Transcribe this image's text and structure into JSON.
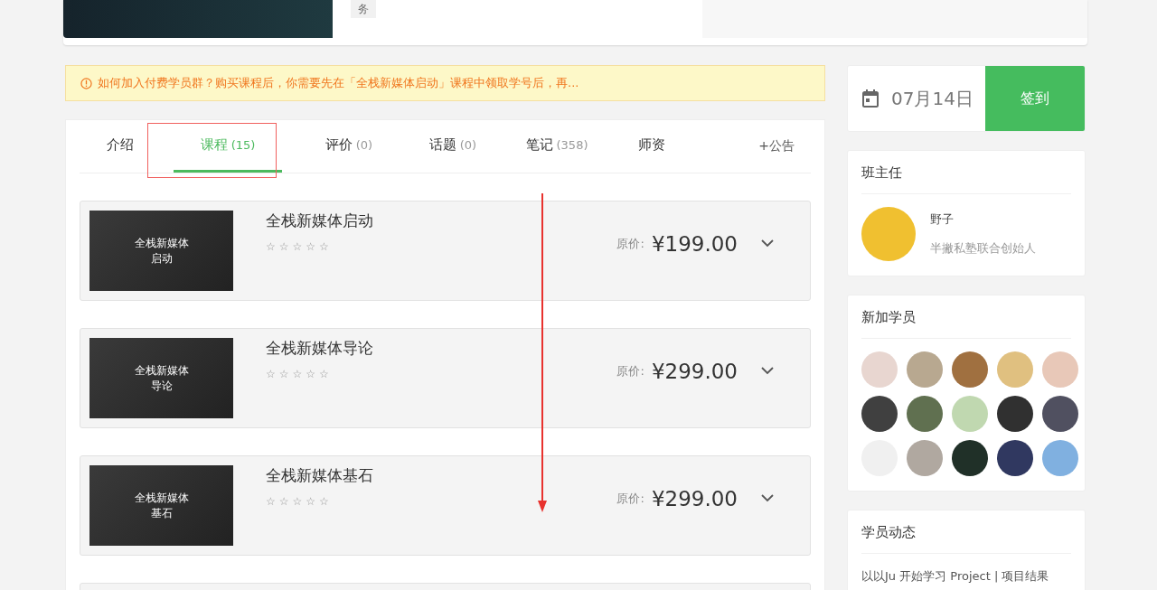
{
  "top_card": {
    "label": "务"
  },
  "notice": {
    "text": "如何加入付费学员群？购买课程后，你需要先在「全栈新媒体启动」课程中领取学号后，再..."
  },
  "tabs": [
    {
      "label": "介绍",
      "selected": false
    },
    {
      "label": "课程",
      "count": "(15)",
      "selected": true
    },
    {
      "label": "评价",
      "count": "(0)",
      "selected": false
    },
    {
      "label": "话题",
      "count": "(0)",
      "selected": false
    },
    {
      "label": "笔记",
      "count": "(358)",
      "selected": false
    },
    {
      "label": "师资",
      "selected": false
    }
  ],
  "announce_button": "+公告",
  "courses": [
    {
      "title": "全栈新媒体启动",
      "thumb_lines": [
        "全栈新媒体",
        "启动"
      ],
      "stars": 0,
      "price_label": "原价:",
      "price": "¥199.00"
    },
    {
      "title": "全栈新媒体导论",
      "thumb_lines": [
        "全栈新媒体",
        "导论"
      ],
      "stars": 0,
      "price_label": "原价:",
      "price": "¥299.00"
    },
    {
      "title": "全栈新媒体基石",
      "thumb_lines": [
        "全栈新媒体",
        "基石"
      ],
      "stars": 0,
      "price_label": "原价:",
      "price": "¥299.00"
    }
  ],
  "checkin": {
    "date": "07月14日",
    "button": "签到"
  },
  "head_teacher": {
    "title": "班主任",
    "name": "野子",
    "role": "半撇私塾联合创始人"
  },
  "new_members": {
    "title": "新加学员",
    "avatars": [
      {
        "color": "#e8d6d0"
      },
      {
        "color": "#b8a890"
      },
      {
        "color": "#a07040"
      },
      {
        "color": "#e0c080"
      },
      {
        "color": "#e8c8b8"
      },
      {
        "color": "#404040"
      },
      {
        "color": "#607050"
      },
      {
        "color": "#c0d8b0"
      },
      {
        "color": "#303030"
      },
      {
        "color": "#505060"
      },
      {
        "color": "#f0f0f0"
      },
      {
        "color": "#b0a8a0"
      },
      {
        "color": "#203028"
      },
      {
        "color": "#303860"
      },
      {
        "color": "#80b0e0"
      }
    ]
  },
  "activity": {
    "title": "学员动态",
    "text": "以以Ju 开始学习 Project | 项目结果"
  }
}
